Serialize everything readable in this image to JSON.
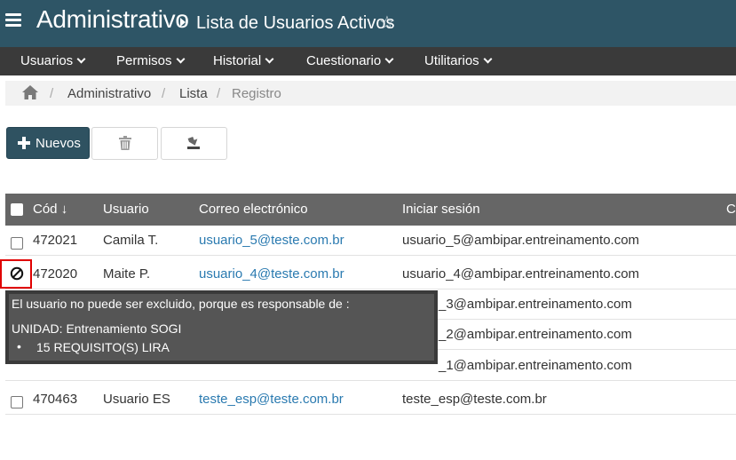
{
  "header": {
    "app_title": "Administrativo",
    "page_subtitle": "Lista de Usuarios Activos",
    "favorite_glyph": "☆",
    "background": "#2e5566"
  },
  "menu": {
    "items": [
      {
        "label": "Usuarios"
      },
      {
        "label": "Permisos"
      },
      {
        "label": "Historial"
      },
      {
        "label": "Cuestionario"
      },
      {
        "label": "Utilitarios"
      }
    ]
  },
  "breadcrumb": {
    "items": [
      "Administrativo",
      "Lista",
      "Registro"
    ],
    "separator": "/"
  },
  "toolbar": {
    "new_label": "Nuevos",
    "delete_icon": "trash-icon",
    "export_icon": "export-icon",
    "accent": "#2f5261"
  },
  "table": {
    "columns": [
      "Cód",
      "Usuario",
      "Correo electrónico",
      "Iniciar sesión",
      "C"
    ],
    "sort_indicator": "↓",
    "rows": [
      {
        "code": "472021",
        "user": "Camila T.",
        "email": "usuario_5@teste.com.br",
        "login": "usuario_5@ambipar.entreinamento.com",
        "status": "checkbox"
      },
      {
        "code": "472020",
        "user": "Maite P.",
        "email": "usuario_4@teste.com.br",
        "login": "usuario_4@ambipar.entreinamento.com",
        "status": "blocked"
      },
      {
        "code": "",
        "user": "",
        "email": "",
        "login": "_3@ambipar.entreinamento.com",
        "status": "hidden"
      },
      {
        "code": "",
        "user": "",
        "email": "",
        "login": "_2@ambipar.entreinamento.com",
        "status": "hidden"
      },
      {
        "code": "",
        "user": "",
        "email": "",
        "login": "_1@ambipar.entreinamento.com",
        "status": "hidden"
      },
      {
        "code": "470463",
        "user": "Usuario ES",
        "email": "teste_esp@teste.com.br",
        "login": "teste_esp@teste.com.br",
        "status": "checkbox"
      }
    ]
  },
  "tooltip": {
    "message": "El usuario no puede ser excluido, porque es responsable de :",
    "unit": "UNIDAD: Entrenamiento SOGI",
    "bullet_char": "•",
    "item": "15 REQUISITO(S) LIRA"
  }
}
